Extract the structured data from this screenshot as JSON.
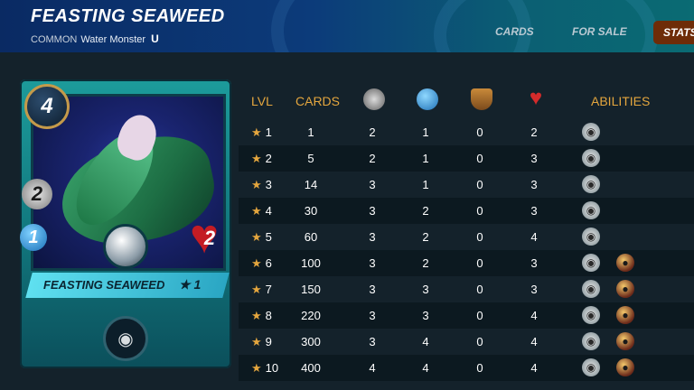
{
  "header": {
    "title": "FEASTING SEAWEED",
    "rarity": "COMMON",
    "type": "Water Monster",
    "edition_icon": "U"
  },
  "tabs": [
    "CARDS",
    "FOR SALE",
    "STATS"
  ],
  "card": {
    "mana": "4",
    "attack": "2",
    "speed": "1",
    "health": "2",
    "name": "FEASTING SEAWEED",
    "level": "★ 1",
    "ability_icon": "eye-icon"
  },
  "table": {
    "headers": {
      "lvl": "LVL",
      "cards": "CARDS",
      "attack_icon": "melee-attack-icon",
      "speed_icon": "speed-icon",
      "armor_icon": "armor-icon",
      "health_icon": "health-icon",
      "abilities": "ABILITIES"
    },
    "rows": [
      {
        "lvl": "1",
        "cards": "1",
        "attack": "2",
        "speed": "1",
        "armor": "0",
        "health": "2",
        "abilities": [
          "eye-icon"
        ]
      },
      {
        "lvl": "2",
        "cards": "5",
        "attack": "2",
        "speed": "1",
        "armor": "0",
        "health": "3",
        "abilities": [
          "eye-icon"
        ]
      },
      {
        "lvl": "3",
        "cards": "14",
        "attack": "3",
        "speed": "1",
        "armor": "0",
        "health": "3",
        "abilities": [
          "eye-icon"
        ]
      },
      {
        "lvl": "4",
        "cards": "30",
        "attack": "3",
        "speed": "2",
        "armor": "0",
        "health": "3",
        "abilities": [
          "eye-icon"
        ]
      },
      {
        "lvl": "5",
        "cards": "60",
        "attack": "3",
        "speed": "2",
        "armor": "0",
        "health": "4",
        "abilities": [
          "eye-icon"
        ]
      },
      {
        "lvl": "6",
        "cards": "100",
        "attack": "3",
        "speed": "2",
        "armor": "0",
        "health": "3",
        "abilities": [
          "eye-icon",
          "bomb-icon"
        ]
      },
      {
        "lvl": "7",
        "cards": "150",
        "attack": "3",
        "speed": "3",
        "armor": "0",
        "health": "3",
        "abilities": [
          "eye-icon",
          "bomb-icon"
        ]
      },
      {
        "lvl": "8",
        "cards": "220",
        "attack": "3",
        "speed": "3",
        "armor": "0",
        "health": "4",
        "abilities": [
          "eye-icon",
          "bomb-icon"
        ]
      },
      {
        "lvl": "9",
        "cards": "300",
        "attack": "3",
        "speed": "4",
        "armor": "0",
        "health": "4",
        "abilities": [
          "eye-icon",
          "bomb-icon"
        ]
      },
      {
        "lvl": "10",
        "cards": "400",
        "attack": "4",
        "speed": "4",
        "armor": "0",
        "health": "4",
        "abilities": [
          "eye-icon",
          "bomb-icon"
        ]
      }
    ]
  },
  "colors": {
    "accent_orange": "#e4a63e",
    "stats_tab_bg": "#6e2c08",
    "header_blue": "#0c3b7a"
  }
}
